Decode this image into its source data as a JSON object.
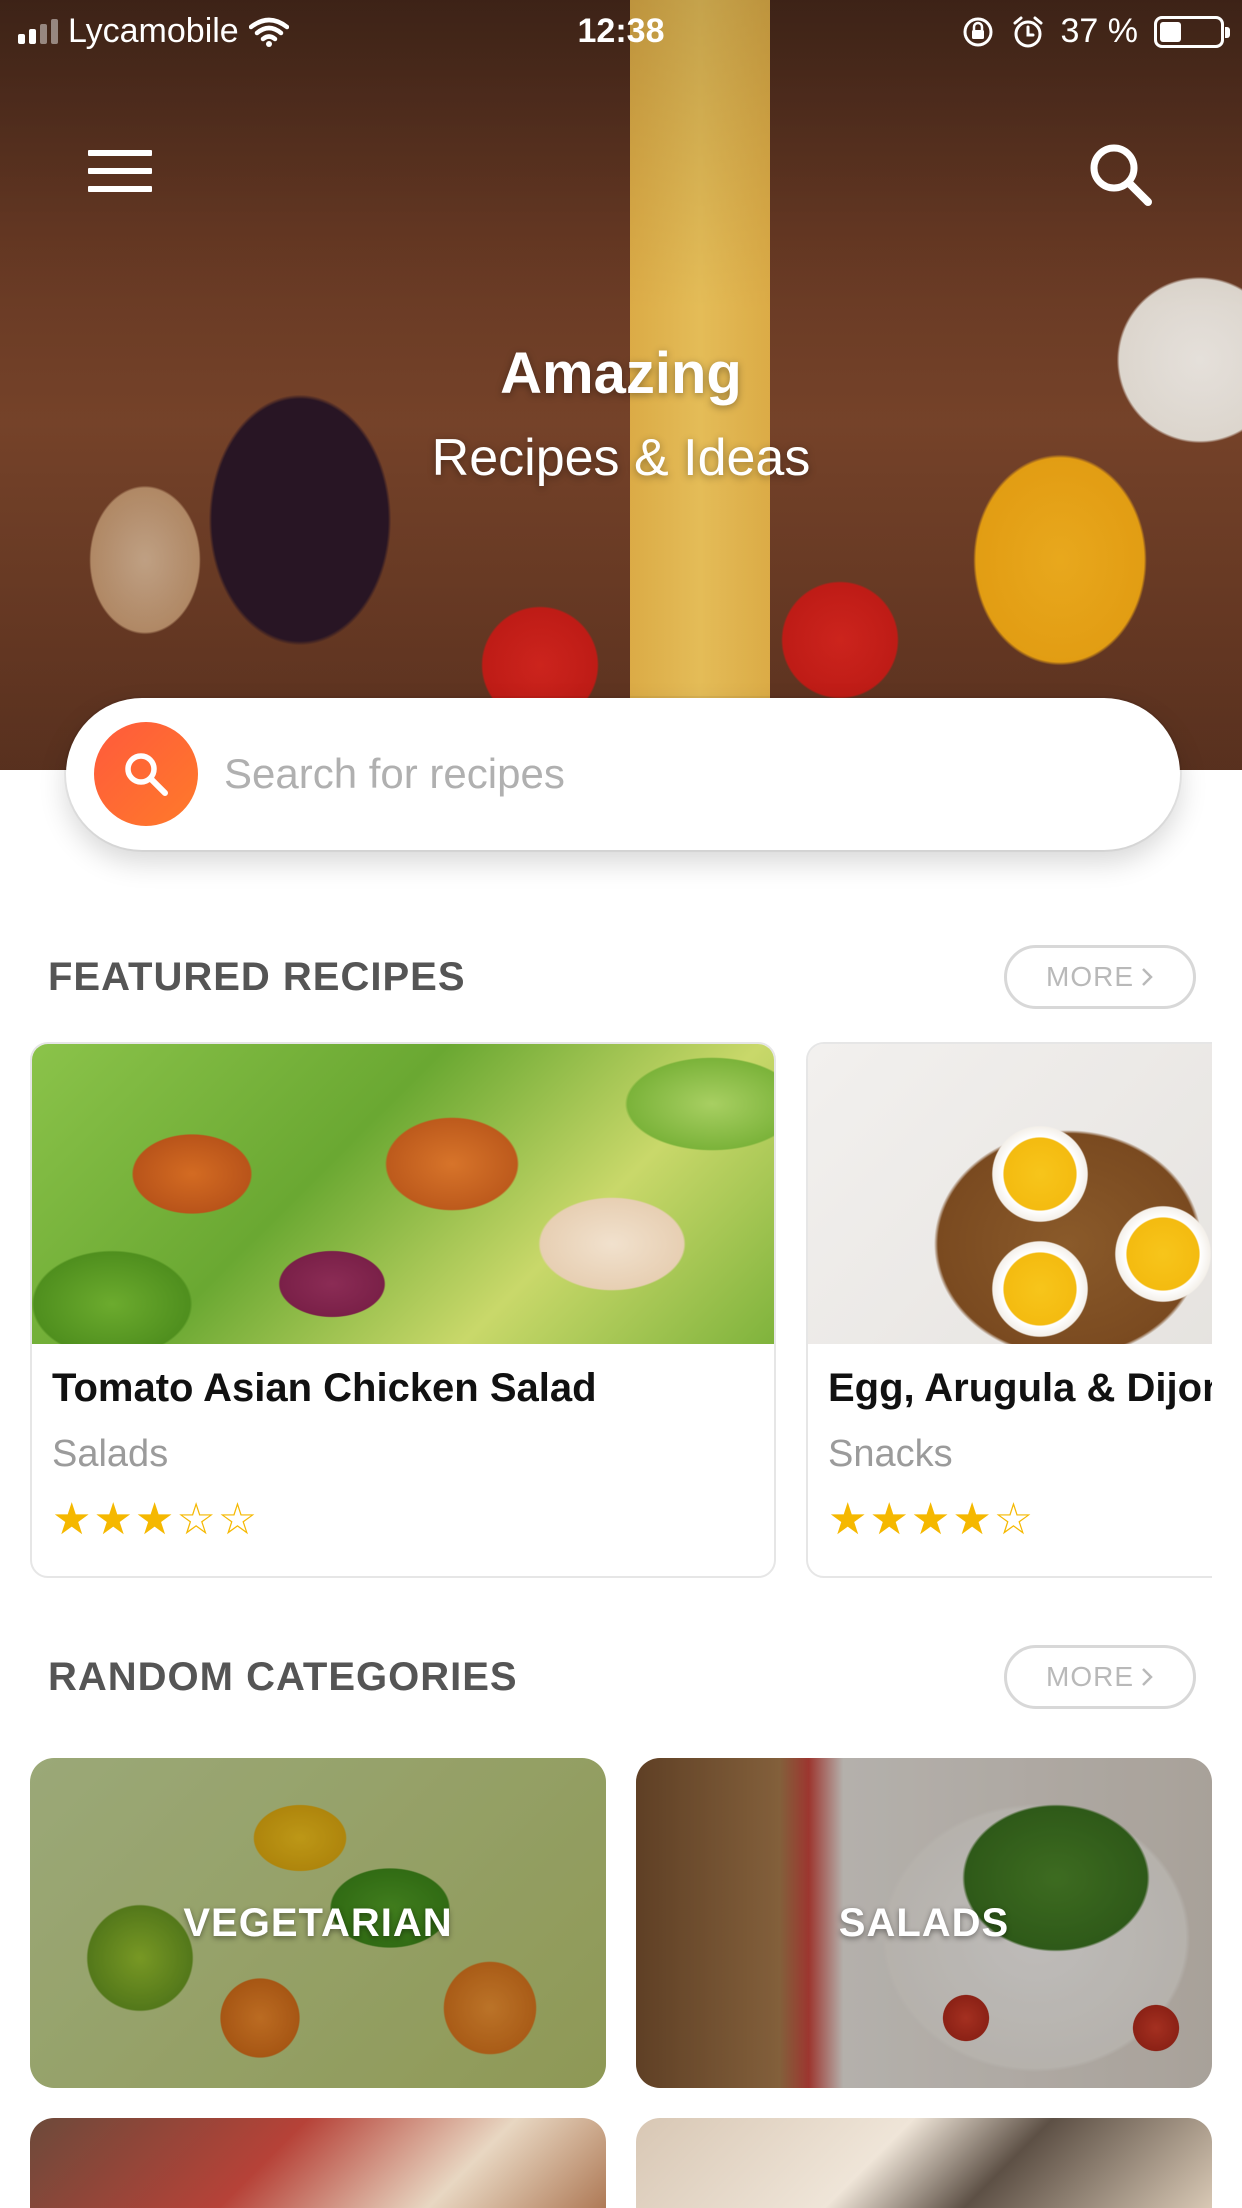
{
  "status_bar": {
    "carrier": "Lycamobile",
    "time": "12:38",
    "battery_text": "37 %",
    "battery_level": 0.37
  },
  "hero": {
    "title": "Amazing",
    "subtitle": "Recipes & Ideas"
  },
  "search": {
    "placeholder": "Search for recipes"
  },
  "featured": {
    "title": "FEATURED RECIPES",
    "more_label": "MORE",
    "recipes": [
      {
        "title": "Tomato Asian Chicken Salad",
        "category": "Salads",
        "rating": 3,
        "stars": "★★★☆☆"
      },
      {
        "title": "Egg, Arugula & Dijon",
        "category": "Snacks",
        "rating": 4,
        "stars": "★★★★☆"
      }
    ]
  },
  "categories": {
    "title": "RANDOM CATEGORIES",
    "more_label": "MORE",
    "items": [
      {
        "label": "VEGETARIAN"
      },
      {
        "label": "SALADS"
      }
    ]
  },
  "colors": {
    "accent": "#ff6a30",
    "star": "#f5b800",
    "section_title": "#555555"
  },
  "icons": {
    "menu": "hamburger-icon",
    "search": "search-icon",
    "more": "chevron-right-icon"
  }
}
